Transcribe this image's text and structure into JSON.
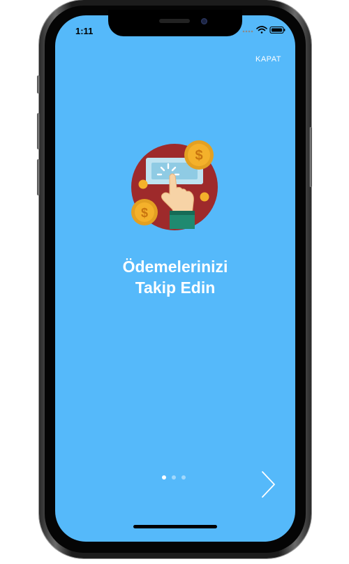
{
  "status_bar": {
    "time": "1:11",
    "icons": [
      "signal-icon",
      "wifi-icon",
      "battery-icon"
    ]
  },
  "onboarding": {
    "close_label": "KAPAT",
    "title_line1": "Ödemelerinizi",
    "title_line2": "Takip Edin",
    "hero_icon": "payment-tracking-icon",
    "page_count": 3,
    "current_page": 1,
    "next_icon": "chevron-right-icon"
  },
  "colors": {
    "background": "#55b9fa",
    "text": "#ffffff",
    "icon_circle": "#9e2a2b",
    "coin": "#f4b12b",
    "sleeve": "#1f8a70"
  }
}
